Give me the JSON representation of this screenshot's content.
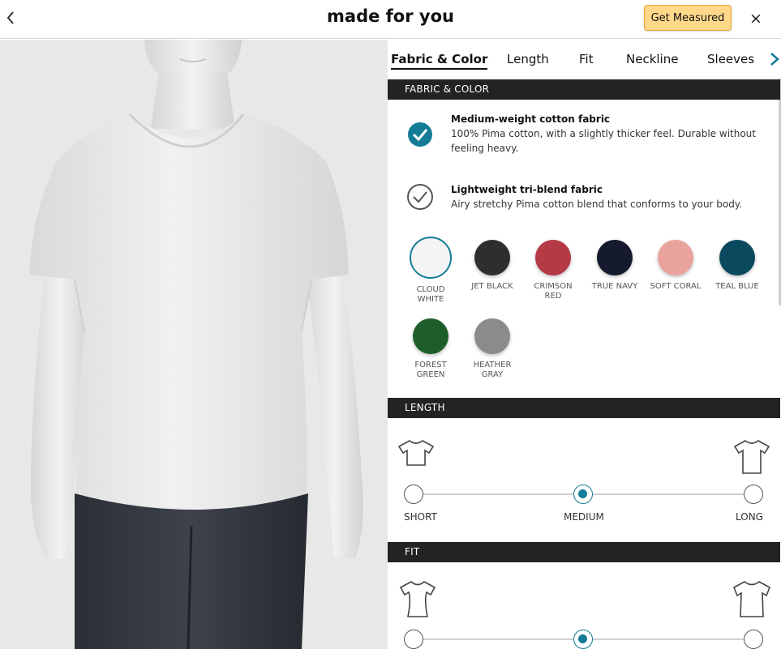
{
  "header": {
    "title": "made for you",
    "measure_label": "Get Measured",
    "close_symbol": "×",
    "accent_color": "#ffd88a"
  },
  "tabs": [
    {
      "label": "Fabric & Color",
      "active": true
    },
    {
      "label": "Length",
      "active": false
    },
    {
      "label": "Fit",
      "active": false
    },
    {
      "label": "Neckline",
      "active": false
    },
    {
      "label": "Sleeves",
      "active": false
    }
  ],
  "fabric": {
    "section_title": "FABRIC & COLOR",
    "options": [
      {
        "title": "Medium-weight cotton fabric",
        "description": "100% Pima cotton, with a slightly thicker feel. Durable without feeling heavy.",
        "selected": true
      },
      {
        "title": "Lightweight tri-blend fabric",
        "description": "Airy stretchy Pima cotton blend that conforms to your body.",
        "selected": false
      }
    ],
    "colors": [
      {
        "name": "CLOUD WHITE",
        "line1": "CLOUD",
        "line2": "WHITE",
        "hex": "#f4f4f4",
        "selected": true
      },
      {
        "name": "JET BLACK",
        "line1": "JET BLACK",
        "line2": "",
        "hex": "#2e2e2e",
        "selected": false
      },
      {
        "name": "CRIMSON RED",
        "line1": "CRIMSON",
        "line2": "RED",
        "hex": "#b53a45",
        "selected": false
      },
      {
        "name": "TRUE NAVY",
        "line1": "TRUE NAVY",
        "line2": "",
        "hex": "#151a2e",
        "selected": false
      },
      {
        "name": "SOFT CORAL",
        "line1": "SOFT CORAL",
        "line2": "",
        "hex": "#e9a39c",
        "selected": false
      },
      {
        "name": "TEAL BLUE",
        "line1": "TEAL BLUE",
        "line2": "",
        "hex": "#0b4a5e",
        "selected": false
      },
      {
        "name": "FOREST GREEN",
        "line1": "FOREST",
        "line2": "GREEN",
        "hex": "#1d5e2a",
        "selected": false
      },
      {
        "name": "HEATHER GRAY",
        "line1": "HEATHER",
        "line2": "GRAY",
        "hex": "#8a8b8d",
        "selected": false
      }
    ]
  },
  "length": {
    "section_title": "LENGTH",
    "options": [
      "SHORT",
      "MEDIUM",
      "LONG"
    ],
    "selected": "MEDIUM"
  },
  "fit": {
    "section_title": "FIT",
    "selected_index": 1
  },
  "colors": {
    "selected_accent": "#147c96",
    "section_bar": "#232323",
    "preview_bg": "#e8e8e8"
  }
}
